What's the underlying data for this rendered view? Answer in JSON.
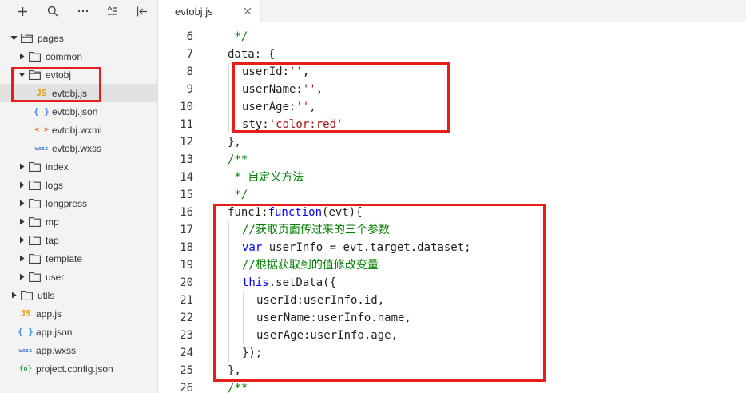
{
  "toolbar": {
    "buttons": [
      {
        "icon": "plus-icon"
      },
      {
        "icon": "search-icon"
      },
      {
        "icon": "more-icon"
      },
      {
        "icon": "sort-list-icon"
      },
      {
        "icon": "collapse-icon"
      }
    ]
  },
  "tree": [
    {
      "label": "pages",
      "type": "folder",
      "expanded": true,
      "depth": 0
    },
    {
      "label": "common",
      "type": "folder",
      "expanded": false,
      "depth": 1
    },
    {
      "label": "evtobj",
      "type": "folder",
      "expanded": true,
      "depth": 1
    },
    {
      "label": "evtobj.js",
      "type": "file",
      "badge": "JS",
      "kind": "js",
      "depth": 2,
      "selected": true
    },
    {
      "label": "evtobj.json",
      "type": "file",
      "badge": "{ }",
      "kind": "json",
      "depth": 2
    },
    {
      "label": "evtobj.wxml",
      "type": "file",
      "badge": "< >",
      "kind": "wxml",
      "depth": 2
    },
    {
      "label": "evtobj.wxss",
      "type": "file",
      "badge": "wxss",
      "kind": "wxss",
      "depth": 2
    },
    {
      "label": "index",
      "type": "folder",
      "expanded": false,
      "depth": 1
    },
    {
      "label": "logs",
      "type": "folder",
      "expanded": false,
      "depth": 1
    },
    {
      "label": "longpress",
      "type": "folder",
      "expanded": false,
      "depth": 1
    },
    {
      "label": "mp",
      "type": "folder",
      "expanded": false,
      "depth": 1
    },
    {
      "label": "tap",
      "type": "folder",
      "expanded": false,
      "depth": 1
    },
    {
      "label": "template",
      "type": "folder",
      "expanded": false,
      "depth": 1
    },
    {
      "label": "user",
      "type": "folder",
      "expanded": false,
      "depth": 1
    },
    {
      "label": "utils",
      "type": "folder",
      "expanded": false,
      "depth": 0
    },
    {
      "label": "app.js",
      "type": "file",
      "badge": "JS",
      "kind": "js",
      "depth": 0
    },
    {
      "label": "app.json",
      "type": "file",
      "badge": "{ }",
      "kind": "json",
      "depth": 0
    },
    {
      "label": "app.wxss",
      "type": "file",
      "badge": "wxss",
      "kind": "wxss",
      "depth": 0
    },
    {
      "label": "project.config.json",
      "type": "file",
      "badge": "{o}",
      "kind": "proj",
      "depth": 0
    }
  ],
  "editor": {
    "tab": {
      "label": "evtobj.js"
    },
    "lines": [
      {
        "n": "6",
        "indent": 1,
        "tokens": [
          {
            "t": " */",
            "c": "cm"
          }
        ]
      },
      {
        "n": "7",
        "indent": 1,
        "tokens": [
          {
            "t": "data: {",
            "c": ""
          }
        ]
      },
      {
        "n": "8",
        "indent": 2,
        "tokens": [
          {
            "t": "userId:",
            "c": ""
          },
          {
            "t": "''",
            "c": "str"
          },
          {
            "t": ",",
            "c": ""
          }
        ]
      },
      {
        "n": "9",
        "indent": 2,
        "tokens": [
          {
            "t": "userName:",
            "c": ""
          },
          {
            "t": "''",
            "c": "str"
          },
          {
            "t": ",",
            "c": ""
          }
        ]
      },
      {
        "n": "10",
        "indent": 2,
        "tokens": [
          {
            "t": "userAge:",
            "c": ""
          },
          {
            "t": "''",
            "c": "str"
          },
          {
            "t": ",",
            "c": ""
          }
        ]
      },
      {
        "n": "11",
        "indent": 2,
        "tokens": [
          {
            "t": "sty:",
            "c": ""
          },
          {
            "t": "'color:red'",
            "c": "str"
          }
        ]
      },
      {
        "n": "12",
        "indent": 1,
        "tokens": [
          {
            "t": "},",
            "c": ""
          }
        ]
      },
      {
        "n": "13",
        "indent": 1,
        "tokens": [
          {
            "t": "/**",
            "c": "cm"
          }
        ]
      },
      {
        "n": "14",
        "indent": 1,
        "tokens": [
          {
            "t": " * 自定义方法",
            "c": "cm"
          }
        ]
      },
      {
        "n": "15",
        "indent": 1,
        "tokens": [
          {
            "t": " */",
            "c": "cm"
          }
        ]
      },
      {
        "n": "16",
        "indent": 1,
        "tokens": [
          {
            "t": "func1:",
            "c": ""
          },
          {
            "t": "function",
            "c": "kw"
          },
          {
            "t": "(evt){",
            "c": ""
          }
        ]
      },
      {
        "n": "17",
        "indent": 2,
        "tokens": [
          {
            "t": "//获取页面传过来的三个参数",
            "c": "cm"
          }
        ]
      },
      {
        "n": "18",
        "indent": 2,
        "tokens": [
          {
            "t": "var",
            "c": "kw"
          },
          {
            "t": " userInfo = evt.target.dataset;",
            "c": ""
          }
        ]
      },
      {
        "n": "19",
        "indent": 2,
        "tokens": [
          {
            "t": "//根据获取到的值修改变量",
            "c": "cm"
          }
        ]
      },
      {
        "n": "20",
        "indent": 2,
        "tokens": [
          {
            "t": "this",
            "c": "kw"
          },
          {
            "t": ".setData({",
            "c": ""
          }
        ]
      },
      {
        "n": "21",
        "indent": 3,
        "tokens": [
          {
            "t": "userId:userInfo.id,",
            "c": ""
          }
        ]
      },
      {
        "n": "22",
        "indent": 3,
        "tokens": [
          {
            "t": "userName:userInfo.name,",
            "c": ""
          }
        ]
      },
      {
        "n": "23",
        "indent": 3,
        "tokens": [
          {
            "t": "userAge:userInfo.age,",
            "c": ""
          }
        ]
      },
      {
        "n": "24",
        "indent": 2,
        "tokens": [
          {
            "t": "});",
            "c": ""
          }
        ]
      },
      {
        "n": "25",
        "indent": 1,
        "tokens": [
          {
            "t": "},",
            "c": ""
          }
        ]
      },
      {
        "n": "26",
        "indent": 1,
        "tokens": [
          {
            "t": "/**",
            "c": "cm"
          }
        ]
      }
    ]
  },
  "colors": {
    "keyword": "#0000ff",
    "string": "#a31515",
    "comment": "#008000",
    "highlight_box": "#e61e1e",
    "sidebar_bg": "#f3f3f3",
    "selected_row": "#e2e2e2"
  }
}
